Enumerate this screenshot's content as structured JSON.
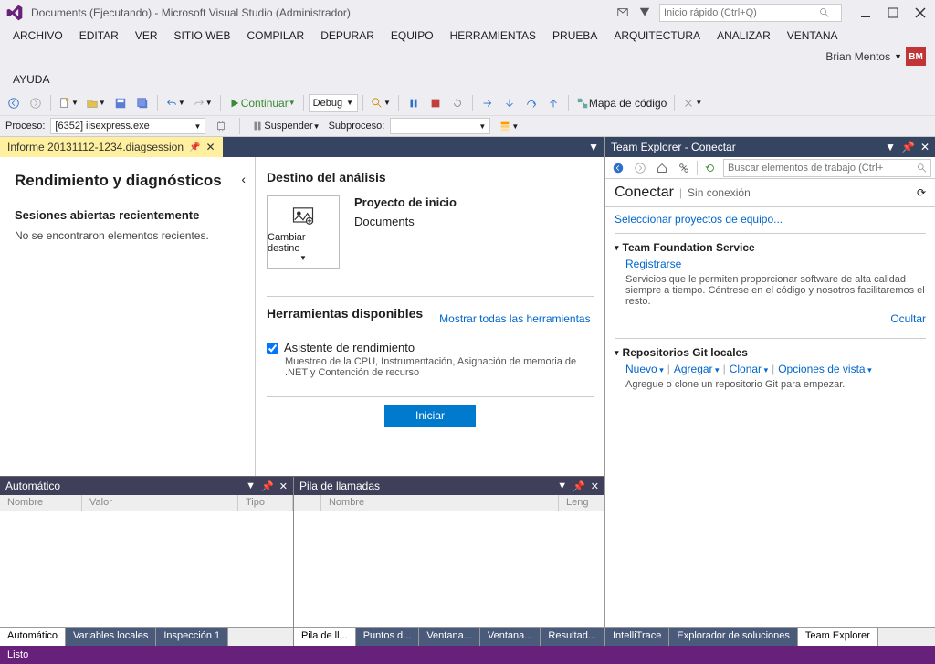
{
  "title": "Documents (Ejecutando) - Microsoft Visual Studio (Administrador)",
  "quickSearch": {
    "placeholder": "Inicio rápido (Ctrl+Q)"
  },
  "user": {
    "name": "Brian Mentos",
    "badge": "BM"
  },
  "menu": [
    "ARCHIVO",
    "EDITAR",
    "VER",
    "SITIO WEB",
    "COMPILAR",
    "DEPURAR",
    "EQUIPO",
    "HERRAMIENTAS",
    "PRUEBA",
    "ARQUITECTURA",
    "ANALIZAR",
    "VENTANA",
    "AYUDA"
  ],
  "toolbar": {
    "continuar": "Continuar",
    "debug": "Debug",
    "mapa": "Mapa de código"
  },
  "processBar": {
    "label": "Proceso:",
    "value": "[6352] iisexpress.exe",
    "suspender": "Suspender",
    "subproceso": "Subproceso:"
  },
  "docTab": "Informe 20131112-1234.diagsession",
  "perf": {
    "heading": "Rendimiento y diagnósticos",
    "recentTitle": "Sesiones abiertas recientemente",
    "recentEmpty": "No se encontraron elementos recientes.",
    "destTitle": "Destino del análisis",
    "changeDest": "Cambiar destino",
    "projTitle": "Proyecto de inicio",
    "projName": "Documents",
    "toolsTitle": "Herramientas disponibles",
    "showAll": "Mostrar todas las herramientas",
    "tool1": "Asistente de rendimiento",
    "tool1desc": "Muestreo de la CPU, Instrumentación, Asignación de memoria de .NET y Contención de recurso",
    "startBtn": "Iniciar"
  },
  "autoPanel": {
    "title": "Automático",
    "cols": [
      "Nombre",
      "Valor",
      "Tipo"
    ],
    "tabs": [
      "Automático",
      "Variables locales",
      "Inspección 1"
    ]
  },
  "callPanel": {
    "title": "Pila de llamadas",
    "cols": [
      "Nombre",
      "Leng"
    ],
    "tabs": [
      "Pila de ll...",
      "Puntos d...",
      "Ventana...",
      "Ventana...",
      "Resultad..."
    ]
  },
  "teamExplorer": {
    "title": "Team Explorer - Conectar",
    "searchPlaceholder": "Buscar elementos de trabajo (Ctrl+",
    "connect": "Conectar",
    "offline": "Sin conexión",
    "selectProjects": "Seleccionar proyectos de equipo...",
    "tfs": {
      "title": "Team Foundation Service",
      "register": "Registrarse",
      "desc": "Servicios que le permiten proporcionar software de alta calidad siempre a tiempo. Céntrese en el código y nosotros facilitaremos el resto.",
      "hide": "Ocultar"
    },
    "git": {
      "title": "Repositorios Git locales",
      "nuevo": "Nuevo",
      "agregar": "Agregar",
      "clonar": "Clonar",
      "opciones": "Opciones de vista",
      "desc": "Agregue o clone un repositorio Git para empezar."
    },
    "bottomTabs": [
      "IntelliTrace",
      "Explorador de soluciones",
      "Team Explorer"
    ]
  },
  "status": "Listo"
}
